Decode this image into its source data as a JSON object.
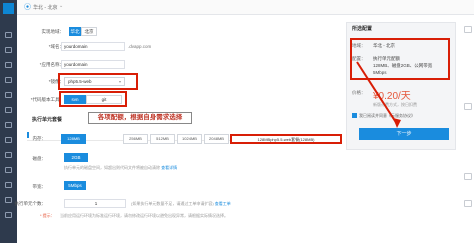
{
  "top": {
    "region": "华北 - 北京"
  },
  "form": {
    "region_label": "实现地域：",
    "region_buttons": [
      "华北",
      "北京"
    ],
    "domain_label": "*域名：",
    "domain_value": "yourdomain",
    "domain_suffix": ".dvapp.com",
    "app_label": "*应用名称：",
    "app_value": "yourdomain",
    "runtime_label": "*镜像：",
    "runtime_value": "php5.5-web",
    "deploy_label": "*代码版本工具：",
    "deploy_options": [
      "svn",
      "git"
    ],
    "callout": "各项配额，根据自身需求选择",
    "section_title": "执行单元套餐",
    "memory_label": "内存：",
    "memory_tiers": [
      "128MB",
      "256MB",
      "512MB",
      "1024MB",
      "2048MB"
    ],
    "memory_selected": "128MBphp5.5-web套餐(128MB)",
    "disk_label": "磁盘：",
    "disk_value": "2GB",
    "disk_note": "执行单元的磁盘空间，如超出则代码文件将被自动清除",
    "disk_note_link": "查看详情",
    "bandwidth_label": "带宽：",
    "bandwidth_value": "5Mbps",
    "instances_label": "执行单元个数：",
    "instances_value": "1",
    "instances_note": "(如果执行单元数量不足，请通过工单申请扩容)",
    "instances_note_link": "查看工单",
    "tips_label": "* 提示：",
    "tips_text": "当前应用运行环境为标准运行环境，请勿修改运行环境以避免出现异常，请根据实际情况选择。"
  },
  "panel": {
    "title": "所选配置",
    "region_label": "地域：",
    "region_value": "华北 - 北京",
    "config_label": "配置：",
    "config_values": [
      "执行单元配额",
      "128MB、磁盘2GB、公网带宽",
      "5Mbps"
    ],
    "price_label": "价格：",
    "price_value": "¥0.20/天",
    "price_note": "新版计费方式，按日扣费",
    "agree_text": "我已阅读并同意《云服务协议》",
    "next_button": "下一步"
  },
  "colors": {
    "accent": "#1a8cde",
    "sidebar": "#2e3a4d",
    "annotation": "#d81e06",
    "price": "#e5573b"
  }
}
